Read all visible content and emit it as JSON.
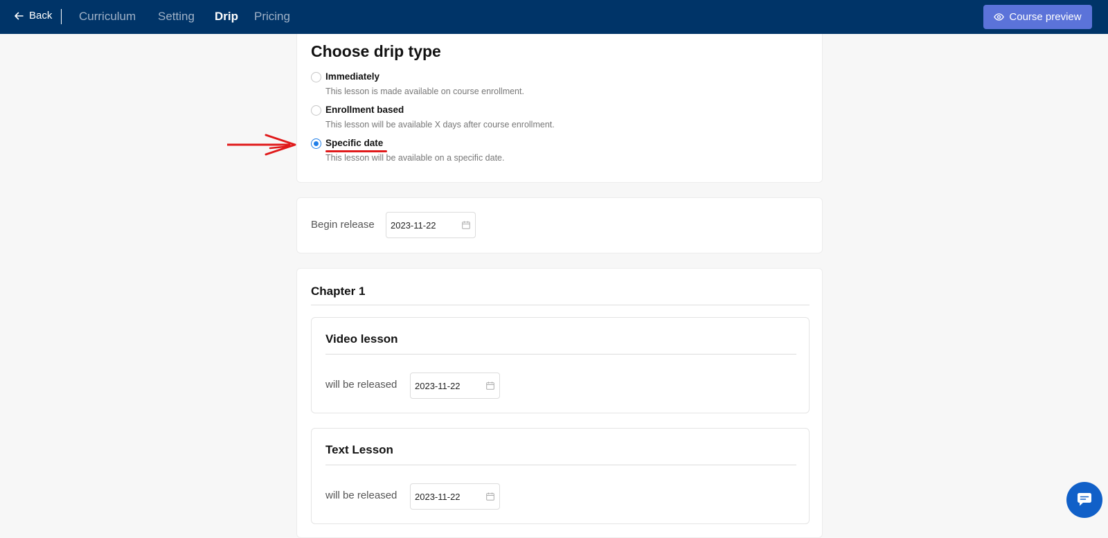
{
  "topbar": {
    "back_label": "Back",
    "tabs": [
      {
        "label": "Curriculum",
        "active": false
      },
      {
        "label": "Setting",
        "active": false
      },
      {
        "label": "Drip",
        "active": true
      },
      {
        "label": "Pricing",
        "active": false
      }
    ],
    "preview_label": "Course preview",
    "preview_icon": "eye-icon",
    "colors": {
      "bar": "#003468",
      "button": "#5b73d9"
    }
  },
  "drip": {
    "title": "Choose drip type",
    "options": [
      {
        "label": "Immediately",
        "description": "This lesson is made available on course enrollment.",
        "checked": false
      },
      {
        "label": "Enrollment based",
        "description": "This lesson will be available X days after course enrollment.",
        "checked": false
      },
      {
        "label": "Specific date",
        "description": "This lesson will be available on a specific date.",
        "checked": true
      }
    ]
  },
  "release": {
    "label": "Begin release",
    "value": "2023-11-22"
  },
  "chapter": {
    "title": "Chapter 1",
    "lessons": [
      {
        "title": "Video lesson",
        "release_label": "will be released",
        "date": "2023-11-22"
      },
      {
        "title": "Text Lesson",
        "release_label": "will be released",
        "date": "2023-11-22"
      }
    ]
  },
  "annotation": {
    "color": "#e0191a"
  },
  "chat": {
    "icon": "chat-bubble-icon",
    "color": "#1160c8"
  }
}
